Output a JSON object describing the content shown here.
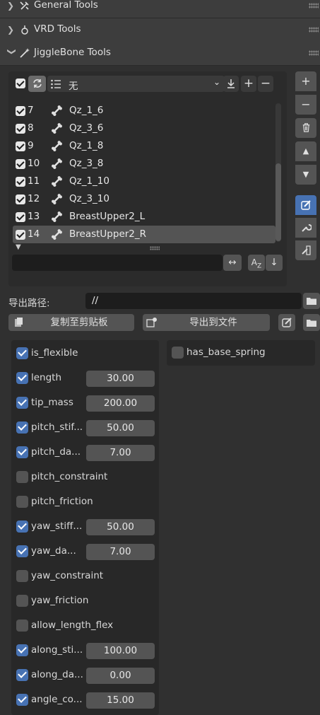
{
  "panels": [
    {
      "label": "General Tools",
      "icon": "tools-icon"
    },
    {
      "label": "VRD Tools",
      "icon": "vrd-icon"
    },
    {
      "label": "JiggleBone Tools",
      "icon": "wand-icon"
    }
  ],
  "list": {
    "selector_label": "无",
    "rows": [
      {
        "index": "7",
        "name": "Qz_1_6"
      },
      {
        "index": "8",
        "name": "Qz_3_6"
      },
      {
        "index": "9",
        "name": "Qz_1_8"
      },
      {
        "index": "10",
        "name": "Qz_3_8"
      },
      {
        "index": "11",
        "name": "Qz_1_10"
      },
      {
        "index": "12",
        "name": "Qz_3_10"
      },
      {
        "index": "13",
        "name": "BreastUpper2_L"
      },
      {
        "index": "14",
        "name": "BreastUpper2_R"
      }
    ],
    "filter_value": ""
  },
  "side_buttons": [
    "+",
    "−"
  ],
  "export": {
    "path_label": "导出路径:",
    "path_value": "//",
    "copy_label": "复制至剪贴板",
    "export_label": "导出到文件"
  },
  "props": [
    {
      "label": "is_flexible",
      "checked": true,
      "value": null
    },
    {
      "label": "length",
      "checked": true,
      "value": "30.00"
    },
    {
      "label": "tip_mass",
      "checked": true,
      "value": "200.00"
    },
    {
      "label": "pitch_stif...",
      "checked": true,
      "value": "50.00"
    },
    {
      "label": "pitch_da...",
      "checked": true,
      "value": "7.00"
    },
    {
      "label": "pitch_constraint",
      "checked": false,
      "value": null
    },
    {
      "label": "pitch_friction",
      "checked": false,
      "value": null
    },
    {
      "label": "yaw_stiff...",
      "checked": true,
      "value": "50.00"
    },
    {
      "label": "yaw_da...",
      "checked": true,
      "value": "7.00"
    },
    {
      "label": "yaw_constraint",
      "checked": false,
      "value": null
    },
    {
      "label": "yaw_friction",
      "checked": false,
      "value": null
    },
    {
      "label": "allow_length_flex",
      "checked": false,
      "value": null
    },
    {
      "label": "along_sti...",
      "checked": true,
      "value": "100.00"
    },
    {
      "label": "along_da...",
      "checked": true,
      "value": "0.00"
    },
    {
      "label": "angle_co...",
      "checked": true,
      "value": "15.00"
    }
  ],
  "right_props": [
    {
      "label": "has_base_spring",
      "checked": false
    }
  ],
  "colors": {
    "accent": "#4772b3",
    "bg": "#303030",
    "field": "#545454"
  }
}
